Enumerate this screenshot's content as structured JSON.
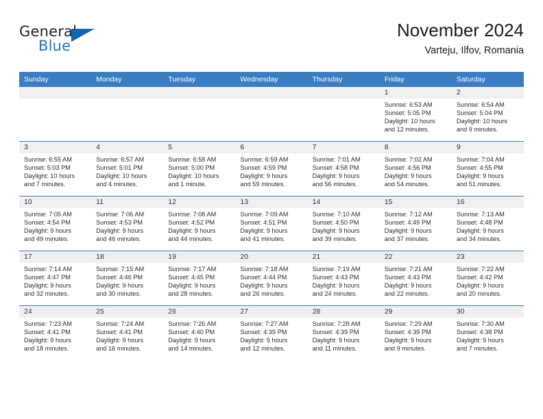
{
  "brand": {
    "word1": "General",
    "word2": "Blue",
    "accent_color": "#1f76c4",
    "triangle_icon": "brand-triangle-icon"
  },
  "header": {
    "title": "November 2024",
    "subtitle": "Varteju, Ilfov, Romania"
  },
  "calendar": {
    "header_bg": "#3a7dc0",
    "daynum_bg": "#f0f0f0",
    "weekdays": [
      "Sunday",
      "Monday",
      "Tuesday",
      "Wednesday",
      "Thursday",
      "Friday",
      "Saturday"
    ],
    "weeks": [
      [
        {
          "day": "",
          "lines": []
        },
        {
          "day": "",
          "lines": []
        },
        {
          "day": "",
          "lines": []
        },
        {
          "day": "",
          "lines": []
        },
        {
          "day": "",
          "lines": []
        },
        {
          "day": "1",
          "lines": [
            "Sunrise: 6:53 AM",
            "Sunset: 5:05 PM",
            "Daylight: 10 hours",
            "and 12 minutes."
          ]
        },
        {
          "day": "2",
          "lines": [
            "Sunrise: 6:54 AM",
            "Sunset: 5:04 PM",
            "Daylight: 10 hours",
            "and 9 minutes."
          ]
        }
      ],
      [
        {
          "day": "3",
          "lines": [
            "Sunrise: 6:55 AM",
            "Sunset: 5:03 PM",
            "Daylight: 10 hours",
            "and 7 minutes."
          ]
        },
        {
          "day": "4",
          "lines": [
            "Sunrise: 6:57 AM",
            "Sunset: 5:01 PM",
            "Daylight: 10 hours",
            "and 4 minutes."
          ]
        },
        {
          "day": "5",
          "lines": [
            "Sunrise: 6:58 AM",
            "Sunset: 5:00 PM",
            "Daylight: 10 hours",
            "and 1 minute."
          ]
        },
        {
          "day": "6",
          "lines": [
            "Sunrise: 6:59 AM",
            "Sunset: 4:59 PM",
            "Daylight: 9 hours",
            "and 59 minutes."
          ]
        },
        {
          "day": "7",
          "lines": [
            "Sunrise: 7:01 AM",
            "Sunset: 4:58 PM",
            "Daylight: 9 hours",
            "and 56 minutes."
          ]
        },
        {
          "day": "8",
          "lines": [
            "Sunrise: 7:02 AM",
            "Sunset: 4:56 PM",
            "Daylight: 9 hours",
            "and 54 minutes."
          ]
        },
        {
          "day": "9",
          "lines": [
            "Sunrise: 7:04 AM",
            "Sunset: 4:55 PM",
            "Daylight: 9 hours",
            "and 51 minutes."
          ]
        }
      ],
      [
        {
          "day": "10",
          "lines": [
            "Sunrise: 7:05 AM",
            "Sunset: 4:54 PM",
            "Daylight: 9 hours",
            "and 49 minutes."
          ]
        },
        {
          "day": "11",
          "lines": [
            "Sunrise: 7:06 AM",
            "Sunset: 4:53 PM",
            "Daylight: 9 hours",
            "and 46 minutes."
          ]
        },
        {
          "day": "12",
          "lines": [
            "Sunrise: 7:08 AM",
            "Sunset: 4:52 PM",
            "Daylight: 9 hours",
            "and 44 minutes."
          ]
        },
        {
          "day": "13",
          "lines": [
            "Sunrise: 7:09 AM",
            "Sunset: 4:51 PM",
            "Daylight: 9 hours",
            "and 41 minutes."
          ]
        },
        {
          "day": "14",
          "lines": [
            "Sunrise: 7:10 AM",
            "Sunset: 4:50 PM",
            "Daylight: 9 hours",
            "and 39 minutes."
          ]
        },
        {
          "day": "15",
          "lines": [
            "Sunrise: 7:12 AM",
            "Sunset: 4:49 PM",
            "Daylight: 9 hours",
            "and 37 minutes."
          ]
        },
        {
          "day": "16",
          "lines": [
            "Sunrise: 7:13 AM",
            "Sunset: 4:48 PM",
            "Daylight: 9 hours",
            "and 34 minutes."
          ]
        }
      ],
      [
        {
          "day": "17",
          "lines": [
            "Sunrise: 7:14 AM",
            "Sunset: 4:47 PM",
            "Daylight: 9 hours",
            "and 32 minutes."
          ]
        },
        {
          "day": "18",
          "lines": [
            "Sunrise: 7:15 AM",
            "Sunset: 4:46 PM",
            "Daylight: 9 hours",
            "and 30 minutes."
          ]
        },
        {
          "day": "19",
          "lines": [
            "Sunrise: 7:17 AM",
            "Sunset: 4:45 PM",
            "Daylight: 9 hours",
            "and 28 minutes."
          ]
        },
        {
          "day": "20",
          "lines": [
            "Sunrise: 7:18 AM",
            "Sunset: 4:44 PM",
            "Daylight: 9 hours",
            "and 26 minutes."
          ]
        },
        {
          "day": "21",
          "lines": [
            "Sunrise: 7:19 AM",
            "Sunset: 4:43 PM",
            "Daylight: 9 hours",
            "and 24 minutes."
          ]
        },
        {
          "day": "22",
          "lines": [
            "Sunrise: 7:21 AM",
            "Sunset: 4:43 PM",
            "Daylight: 9 hours",
            "and 22 minutes."
          ]
        },
        {
          "day": "23",
          "lines": [
            "Sunrise: 7:22 AM",
            "Sunset: 4:42 PM",
            "Daylight: 9 hours",
            "and 20 minutes."
          ]
        }
      ],
      [
        {
          "day": "24",
          "lines": [
            "Sunrise: 7:23 AM",
            "Sunset: 4:41 PM",
            "Daylight: 9 hours",
            "and 18 minutes."
          ]
        },
        {
          "day": "25",
          "lines": [
            "Sunrise: 7:24 AM",
            "Sunset: 4:41 PM",
            "Daylight: 9 hours",
            "and 16 minutes."
          ]
        },
        {
          "day": "26",
          "lines": [
            "Sunrise: 7:26 AM",
            "Sunset: 4:40 PM",
            "Daylight: 9 hours",
            "and 14 minutes."
          ]
        },
        {
          "day": "27",
          "lines": [
            "Sunrise: 7:27 AM",
            "Sunset: 4:39 PM",
            "Daylight: 9 hours",
            "and 12 minutes."
          ]
        },
        {
          "day": "28",
          "lines": [
            "Sunrise: 7:28 AM",
            "Sunset: 4:39 PM",
            "Daylight: 9 hours",
            "and 11 minutes."
          ]
        },
        {
          "day": "29",
          "lines": [
            "Sunrise: 7:29 AM",
            "Sunset: 4:39 PM",
            "Daylight: 9 hours",
            "and 9 minutes."
          ]
        },
        {
          "day": "30",
          "lines": [
            "Sunrise: 7:30 AM",
            "Sunset: 4:38 PM",
            "Daylight: 9 hours",
            "and 7 minutes."
          ]
        }
      ]
    ]
  }
}
